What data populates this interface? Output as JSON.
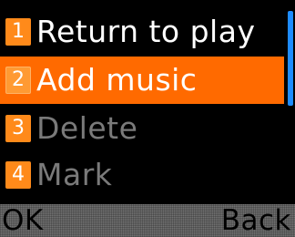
{
  "menu": {
    "items": [
      {
        "number": "1",
        "label": "Return to play",
        "state": "normal"
      },
      {
        "number": "2",
        "label": "Add music",
        "state": "selected"
      },
      {
        "number": "3",
        "label": "Delete",
        "state": "disabled"
      },
      {
        "number": "4",
        "label": "Mark",
        "state": "disabled"
      }
    ]
  },
  "softkeys": {
    "left": "OK",
    "right": "Back"
  },
  "colors": {
    "background": "#000000",
    "selection": "#FF6A00",
    "badge": "#FF8A1A",
    "scroll_thumb": "#1E8CFF",
    "softkey_bar": "#737373",
    "disabled_text": "#7A7A7A"
  }
}
